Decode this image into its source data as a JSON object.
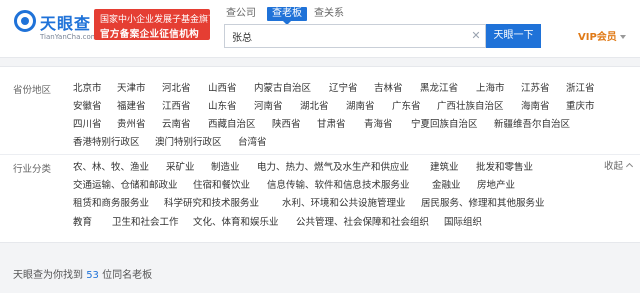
{
  "brand": {
    "name": "天眼查",
    "domain": "TianYanCha.com",
    "banner_line1": "国家中小企业发展子基金旗下",
    "banner_line2": "官方备案企业征信机构"
  },
  "search": {
    "tabs": [
      {
        "label": "查公司",
        "active": false
      },
      {
        "label": "查老板",
        "active": true
      },
      {
        "label": "查关系",
        "active": false
      }
    ],
    "query": "张总",
    "button_label": "天眼一下"
  },
  "account": {
    "vip_label": "VIP会员"
  },
  "filters": {
    "region_label": "省份地区",
    "regions": [
      [
        "北京市",
        "天津市",
        "河北省",
        "山西省",
        "内蒙古自治区",
        "辽宁省",
        "吉林省",
        "黑龙江省",
        "上海市",
        "江苏省",
        "浙江省"
      ],
      [
        "安徽省",
        "福建省",
        "江西省",
        "山东省",
        "河南省",
        "湖北省",
        "湖南省",
        "广东省",
        "广西壮族自治区",
        "海南省",
        "重庆市"
      ],
      [
        "四川省",
        "贵州省",
        "云南省",
        "西藏自治区",
        "陕西省",
        "甘肃省",
        "青海省",
        "宁夏回族自治区",
        "新疆维吾尔自治区"
      ],
      [
        "香港特别行政区",
        "澳门特别行政区",
        "台湾省"
      ]
    ],
    "industry_label": "行业分类",
    "industries": [
      [
        "农、林、牧、渔业",
        "采矿业",
        "制造业",
        "电力、热力、燃气及水生产和供应业",
        "建筑业",
        "批发和零售业"
      ],
      [
        "交通运输、仓储和邮政业",
        "住宿和餐饮业",
        "信息传输、软件和信息技术服务业",
        "金融业",
        "房地产业"
      ],
      [
        "租赁和商务服务业",
        "科学研究和技术服务业",
        "水利、环境和公共设施管理业",
        "居民服务、修理和其他服务业"
      ],
      [
        "教育",
        "卫生和社会工作",
        "文化、体育和娱乐业",
        "公共管理、社会保障和社会组织",
        "国际组织"
      ]
    ],
    "collapse_label": "收起"
  },
  "result": {
    "prefix": "天眼查为你找到",
    "count": "53",
    "suffix": "位同名老板"
  }
}
